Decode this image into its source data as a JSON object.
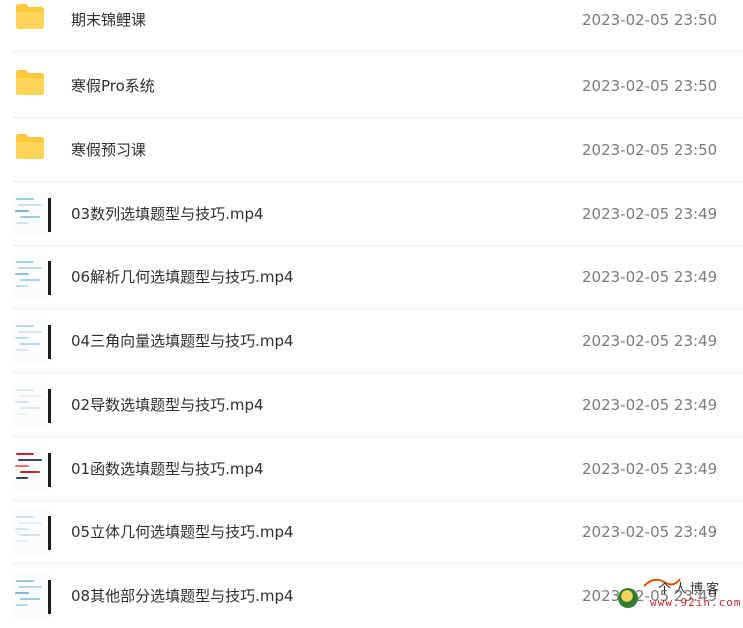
{
  "files": [
    {
      "name": "期末锦鲤课",
      "date": "2023-02-05 23:50",
      "type": "folder",
      "icon": "folder-icon"
    },
    {
      "name": "寒假Pro系统",
      "date": "2023-02-05 23:50",
      "type": "folder",
      "icon": "folder-icon"
    },
    {
      "name": "寒假预习课",
      "date": "2023-02-05 23:50",
      "type": "folder",
      "icon": "folder-icon"
    },
    {
      "name": "03数列选填题型与技巧.mp4",
      "date": "2023-02-05 23:49",
      "type": "video",
      "icon": "video-thumbnail"
    },
    {
      "name": "06解析几何选填题型与技巧.mp4",
      "date": "2023-02-05 23:49",
      "type": "video",
      "icon": "video-thumbnail"
    },
    {
      "name": "04三角向量选填题型与技巧.mp4",
      "date": "2023-02-05 23:49",
      "type": "video",
      "icon": "video-thumbnail"
    },
    {
      "name": "02导数选填题型与技巧.mp4",
      "date": "2023-02-05 23:49",
      "type": "video",
      "icon": "video-thumbnail"
    },
    {
      "name": "01函数选填题型与技巧.mp4",
      "date": "2023-02-05 23:49",
      "type": "video",
      "icon": "video-thumbnail"
    },
    {
      "name": "05立体几何选填题型与技巧.mp4",
      "date": "2023-02-05 23:49",
      "type": "video",
      "icon": "video-thumbnail"
    },
    {
      "name": "08其他部分选填题型与技巧.mp4",
      "date": "2023-02-05 23:49",
      "type": "video",
      "icon": "video-thumbnail"
    }
  ],
  "watermark": {
    "title": "个人博客",
    "url": "www.92in.com"
  },
  "colors": {
    "folder": "#fcc93c",
    "name_text": "#2f2f2f",
    "date_text": "#7b7b7b",
    "divider": "#ececec"
  }
}
